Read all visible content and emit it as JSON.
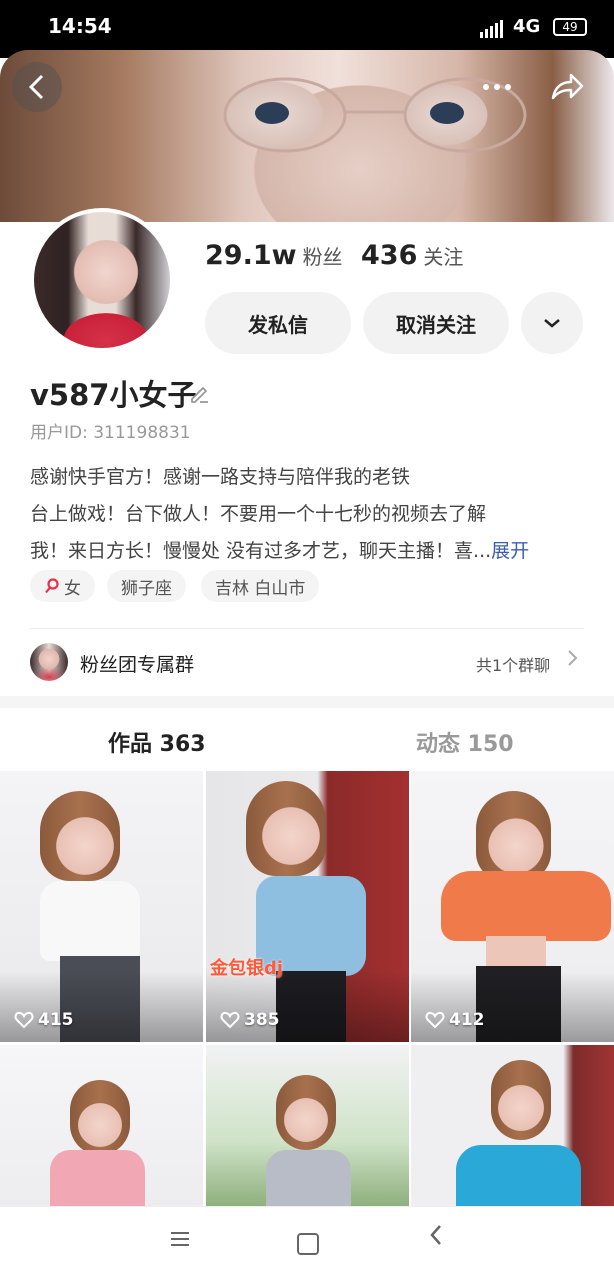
{
  "status_bar": {
    "time": "14:54",
    "network": "4G",
    "battery": "49"
  },
  "header": {
    "back_icon": "back-chevron-icon",
    "more_icon": "more-dots-icon",
    "share_icon": "share-icon"
  },
  "profile": {
    "fans_count": "29.1w",
    "fans_label": "粉丝",
    "follow_count": "436",
    "follow_label": "关注",
    "message_button": "发私信",
    "unfollow_button": "取消关注",
    "username": "v587小女子",
    "user_id": "用户ID: 311198831",
    "bio_line1": "感谢快手官方！感谢一路支持与陪伴我的老铁",
    "bio_line2": "台上做戏！台下做人！不要用一个十七秒的视频去了解",
    "bio_line3": "我！来日方长！慢慢处 没有过多才艺，聊天主播！喜...",
    "expand_label": "展开",
    "tags": {
      "gender": "女",
      "zodiac": "狮子座",
      "location": "吉林 白山市"
    }
  },
  "fan_group": {
    "title": "粉丝团专属群",
    "count": "共1个群聊"
  },
  "tabs": {
    "works": "作品 363",
    "moments": "动态 150"
  },
  "videos": [
    {
      "likes": "415",
      "caption": ""
    },
    {
      "likes": "385",
      "caption": "金包银dj"
    },
    {
      "likes": "412",
      "caption": ""
    },
    {
      "likes": "",
      "caption": ""
    },
    {
      "likes": "",
      "caption": ""
    },
    {
      "likes": "",
      "caption": ""
    }
  ],
  "colors": {
    "accent_link": "#3b5fb0",
    "gender_icon": "#e8324b",
    "caption": "#ff5a3a"
  }
}
